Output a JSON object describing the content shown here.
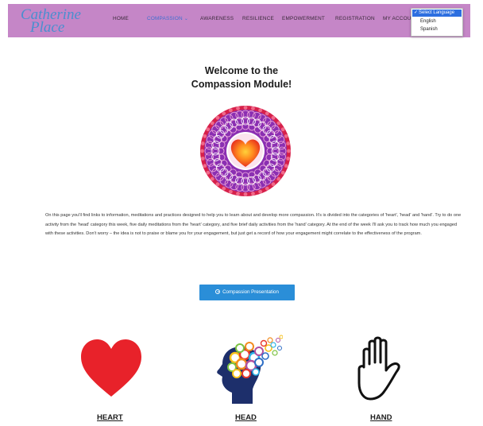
{
  "header": {
    "logo": {
      "line1": "Catherine",
      "line2": "Place"
    },
    "nav": [
      {
        "label": "HOME"
      },
      {
        "label": "COMPASSION"
      },
      {
        "label": "AWARENESS"
      },
      {
        "label": "RESILIENCE"
      },
      {
        "label": "EMPOWERMENT"
      },
      {
        "label": "REGISTRATION"
      },
      {
        "label": "MY ACCOUNT"
      }
    ],
    "language": {
      "options": [
        "Select Language",
        "English",
        "Spanish"
      ]
    }
  },
  "colors": {
    "header_bg": "#c586c7",
    "accent": "#2a8ed8",
    "heart_red": "#e8222a"
  },
  "main": {
    "title_line1": "Welcome to the",
    "title_line2": "Compassion Module!",
    "intro": "On this page you'll find links to information, meditations and practices designed to help you to learn about and develop more compassion. It's is divided into the categories of 'heart', 'head' and 'hand'.  Try to do one activity from the 'head' category this week, five daily meditations from the 'heart' category, and five brief daily activities from the 'hand' category.  At the end of the week I'll ask you to track how much you engaged with these activities.  Don't worry – the idea is not to praise or blame you for your engagement, but just get a record of how your engagement might correlate to the effectiveness of the program.",
    "button_label": "Compassion Presentation",
    "categories": [
      {
        "label": "HEART",
        "icon": "heart-icon"
      },
      {
        "label": "HEAD",
        "icon": "head-icon"
      },
      {
        "label": "HAND",
        "icon": "hand-icon"
      }
    ]
  }
}
